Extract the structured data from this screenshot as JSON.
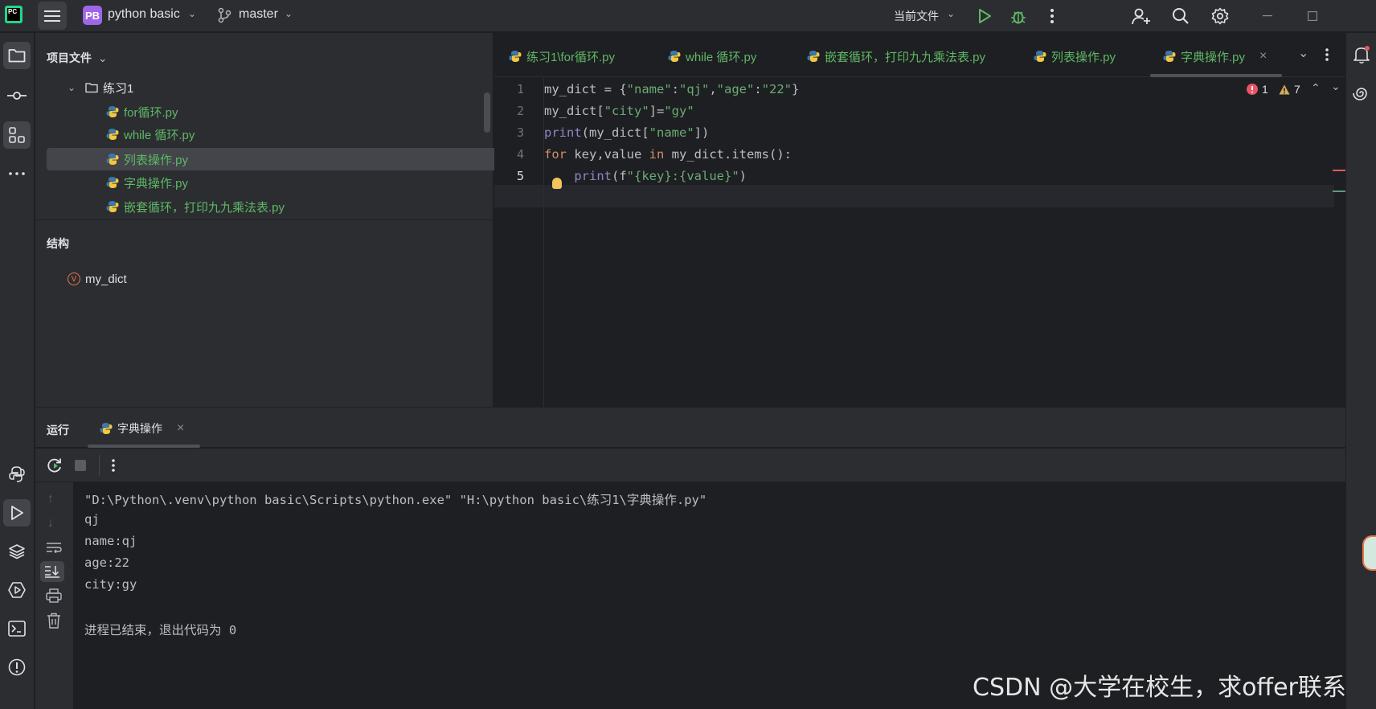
{
  "titlebar": {
    "logo_text": "PC",
    "project_badge": "PB",
    "project_name": "python basic",
    "branch": "master",
    "run_config": "当前文件"
  },
  "project_panel": {
    "title": "项目文件",
    "folder": "练习1",
    "files": [
      "for循环.py",
      "while 循环.py",
      "列表操作.py",
      "字典操作.py",
      "嵌套循环，打印九九乘法表.py"
    ],
    "selected_index": 2
  },
  "structure_panel": {
    "title": "结构",
    "item_badge": "V",
    "item": "my_dict"
  },
  "editor": {
    "tabs": [
      "练习1\\for循环.py",
      "while 循环.py",
      "嵌套循环，打印九九乘法表.py",
      "列表操作.py",
      "字典操作.py"
    ],
    "active_tab_index": 4,
    "line_numbers": [
      "1",
      "2",
      "3",
      "4",
      "5"
    ],
    "lines": [
      "my_dict = {\"name\":\"qj\",\"age\":\"22\"}",
      "my_dict[\"city\"]=\"gy\"",
      "print(my_dict[\"name\"])",
      "for key,value in my_dict.items():",
      "    print(f\"{key}:{value}\")"
    ],
    "errors": "1",
    "warnings": "7"
  },
  "run_panel": {
    "title": "运行",
    "tab": "字典操作",
    "output": [
      "\"D:\\Python\\.venv\\python basic\\Scripts\\python.exe\" \"H:\\python basic\\练习1\\字典操作.py\"",
      "qj",
      "name:qj",
      "age:22",
      "city:gy",
      "",
      "进程已结束，退出代码为 0"
    ]
  },
  "watermark": "CSDN @大学在校生，求offer联系",
  "colors": {
    "accent_green": "#5fb865",
    "project_badge": "#9f66e8",
    "error": "#e55765",
    "warning": "#d6ae58"
  }
}
